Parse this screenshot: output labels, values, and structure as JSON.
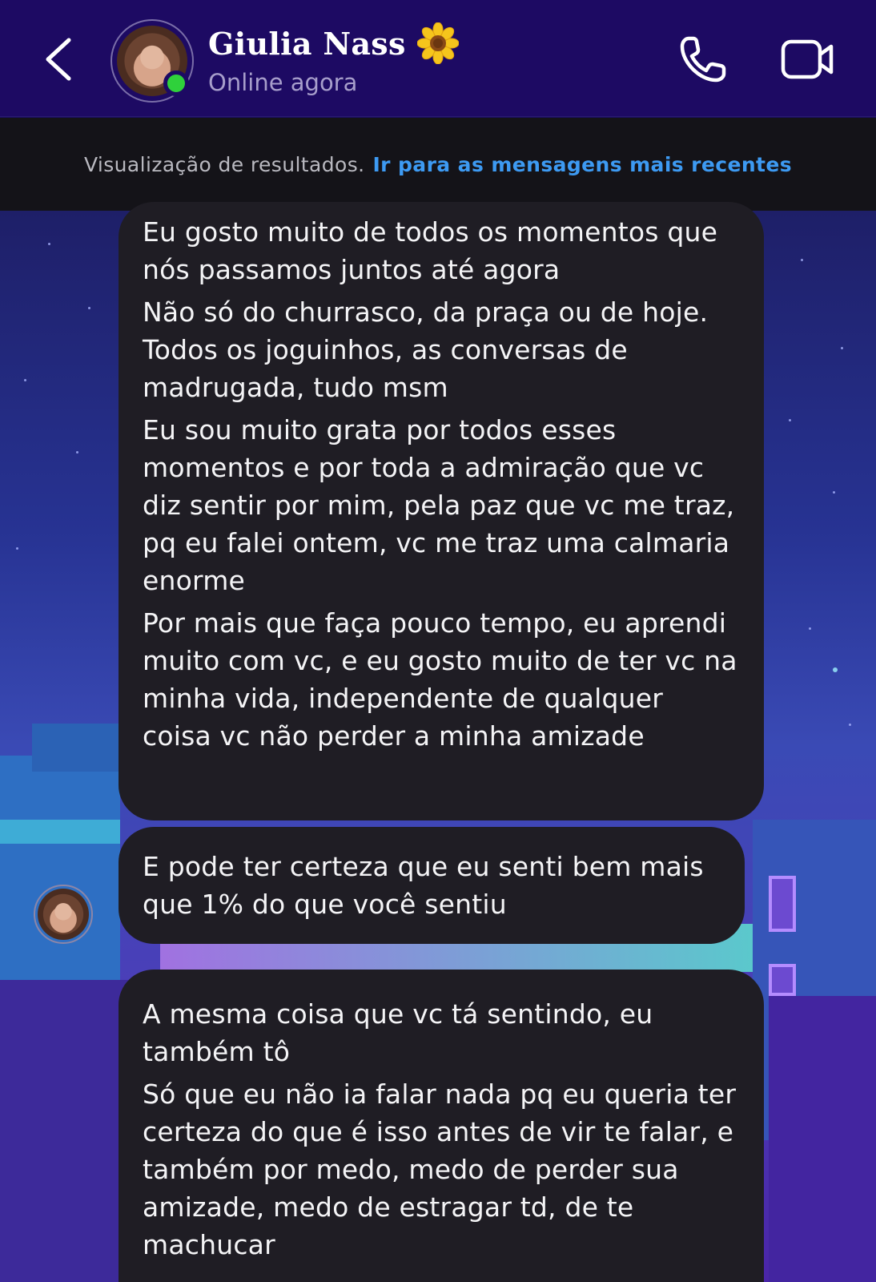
{
  "header": {
    "contact_name": "Giulia Nass",
    "status": "Online agora",
    "back_icon": "chevron-left-icon",
    "call_icon": "phone-icon",
    "video_icon": "video-camera-icon",
    "name_emoji": "sunflower-icon"
  },
  "notice": {
    "text": "Visualização de resultados.",
    "link": "Ir para as mensagens mais recentes"
  },
  "messages": [
    {
      "lines": [
        "Eu gosto muito de todos os momentos que nós passamos juntos até agora",
        "Não só do churrasco, da praça ou de hoje. Todos os joguinhos, as conversas de madrugada, tudo msm",
        "Eu sou muito grata por todos esses momentos e por toda a admiração que vc diz sentir por mim, pela paz que vc me traz, pq eu falei ontem, vc me traz uma calmaria enorme",
        "Por mais que faça pouco tempo, eu aprendi muito com vc, e eu gosto muito de ter vc na minha vida, independente de qualquer coisa vc não perder a minha amizade"
      ]
    },
    {
      "lines": [
        "E pode ter certeza que eu senti bem mais que 1% do que você sentiu"
      ]
    },
    {
      "lines": [
        "A mesma coisa que vc tá sentindo, eu também tô",
        "Só que eu não ia falar nada pq eu queria ter certeza do que é isso antes de vir te falar, e também por medo, medo de perder sua amizade, medo de estragar td, de te machucar"
      ]
    }
  ],
  "colors": {
    "header_bg": "#1d0a63",
    "bubble_bg": "#1f1d24",
    "link": "#3d9af2",
    "online": "#2fd13b"
  }
}
